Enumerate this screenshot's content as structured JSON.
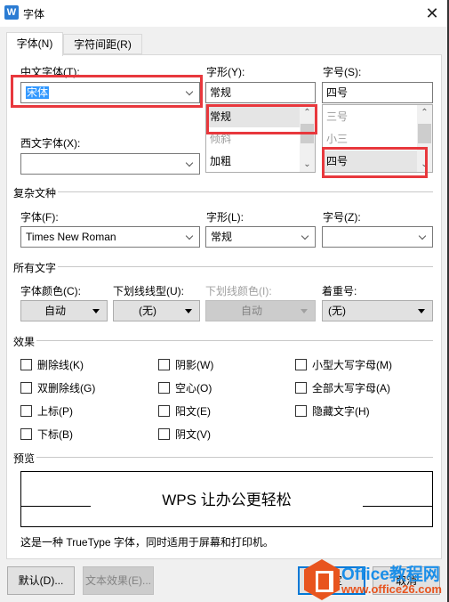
{
  "window": {
    "title": "字体",
    "app_icon": "W",
    "close_label": "✕"
  },
  "tabs": [
    {
      "label": "字体(N)",
      "active": true
    },
    {
      "label": "字符间距(R)",
      "active": false
    }
  ],
  "chinese_font": {
    "label": "中文字体(T):",
    "value": "宋体"
  },
  "font_style": {
    "label": "字形(Y):",
    "value": "常规",
    "options": [
      "常规",
      "倾斜",
      "加粗"
    ],
    "selected_index": 0
  },
  "font_size": {
    "label": "字号(S):",
    "value": "四号",
    "options": [
      "三号",
      "小三",
      "四号"
    ],
    "selected_index": 2
  },
  "western_font": {
    "label": "西文字体(X):",
    "value": ""
  },
  "complex_script": {
    "group_title": "复杂文种",
    "font_label": "字体(F):",
    "font_value": "Times New Roman",
    "style_label": "字形(L):",
    "style_value": "常规",
    "size_label": "字号(Z):",
    "size_value": ""
  },
  "all_text": {
    "group_title": "所有文字",
    "font_color_label": "字体颜色(C):",
    "font_color_value": "自动",
    "underline_type_label": "下划线线型(U):",
    "underline_type_value": "(无)",
    "underline_color_label": "下划线颜色(I):",
    "underline_color_value": "自动",
    "emphasis_label": "着重号:",
    "emphasis_value": "(无)"
  },
  "effects": {
    "group_title": "效果",
    "checkboxes": [
      {
        "label": "删除线(K)",
        "checked": false
      },
      {
        "label": "双删除线(G)",
        "checked": false
      },
      {
        "label": "上标(P)",
        "checked": false
      },
      {
        "label": "下标(B)",
        "checked": false
      },
      {
        "label": "阴影(W)",
        "checked": false
      },
      {
        "label": "空心(O)",
        "checked": false
      },
      {
        "label": "阳文(E)",
        "checked": false
      },
      {
        "label": "阴文(V)",
        "checked": false
      },
      {
        "label": "小型大写字母(M)",
        "checked": false
      },
      {
        "label": "全部大写字母(A)",
        "checked": false
      },
      {
        "label": "隐藏文字(H)",
        "checked": false
      }
    ]
  },
  "preview": {
    "group_title": "预览",
    "sample_text": "WPS 让办公更轻松",
    "description": "这是一种 TrueType 字体，同时适用于屏幕和打印机。"
  },
  "buttons": {
    "default": "默认(D)...",
    "text_effects": "文本效果(E)...",
    "ok": "确定",
    "cancel": "取消"
  },
  "watermark": {
    "line1": "Office教程网",
    "line2": "www.office26.com"
  },
  "colors": {
    "highlight_border": "#e8383d",
    "selection": "#3399ff",
    "focus_border": "#0078d7"
  }
}
